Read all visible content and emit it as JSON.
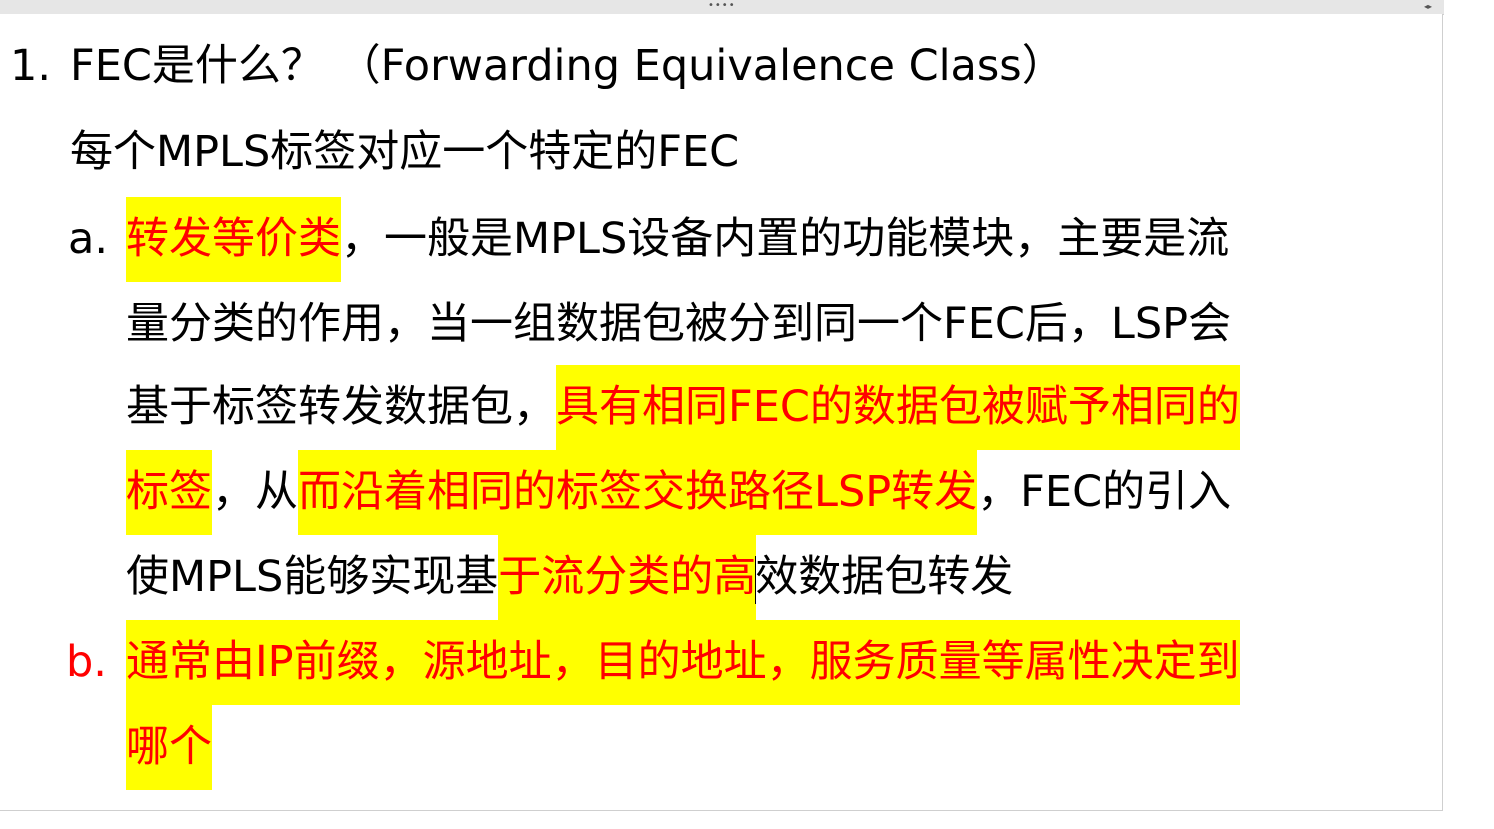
{
  "toolbar": {
    "grip": "••••",
    "arrows": "◂▸"
  },
  "heading": {
    "number": "1.",
    "title": "FEC是什么？ （Forwarding Equivalence Class）"
  },
  "subheading": "每个MPLS标签对应一个特定的FEC",
  "item_a": {
    "marker": "a.",
    "line1": {
      "hl": "转发等价类",
      "rest": "，一般是MPLS设备内置的功能模块，主要是流"
    },
    "line2": "量分类的作用，当一组数据包被分到同一个FEC后，LSP会",
    "line3": {
      "plain": "基于标签转发数据包，",
      "hl_red": "具有相同FEC的数据包被赋予相同的"
    },
    "line4": {
      "hl_red1": "标签",
      "plain1": "，从",
      "hl_red2": "而沿着相同的标签交换路径LSP转发",
      "plain2": "，FEC的引入"
    },
    "line5": {
      "plain1": "使MPLS能够实现基",
      "hl_red": "于流分类的高",
      "plain2": "效数据包转发"
    }
  },
  "item_b": {
    "marker": "b.",
    "line1": "通常由IP前缀，源地址，目的地址，服务质量等属性决定到",
    "line2": "哪个"
  },
  "colors": {
    "highlight": "#ffff00",
    "emphasis": "#ff0000"
  }
}
